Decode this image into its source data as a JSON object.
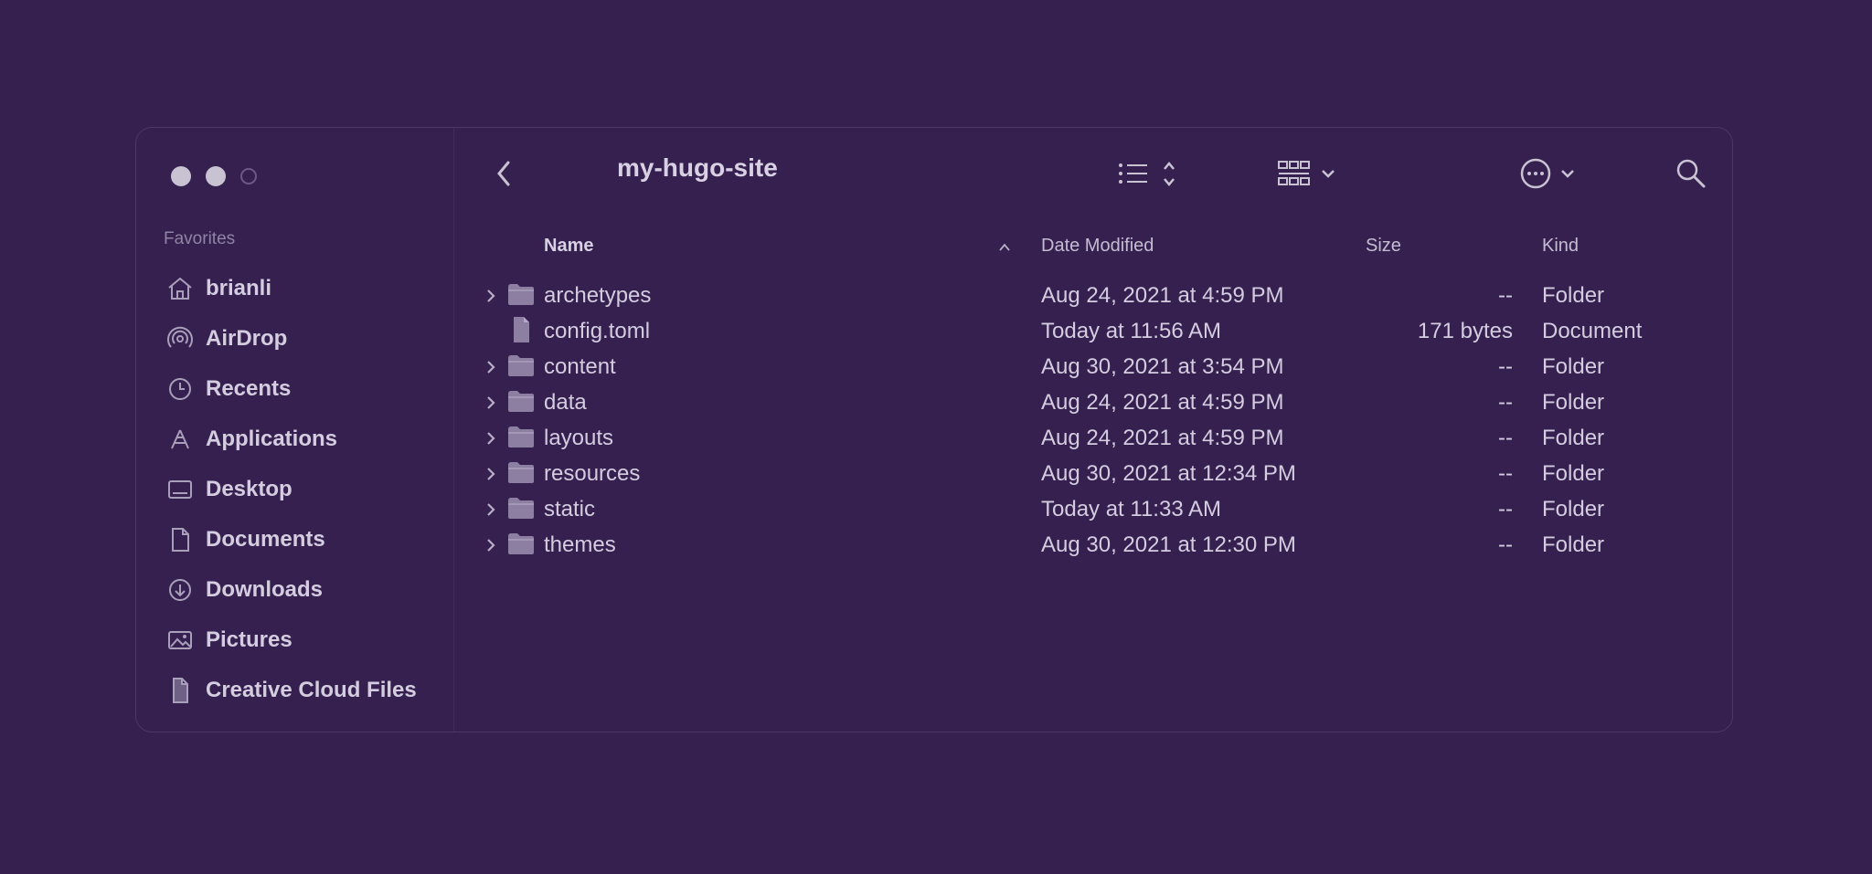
{
  "window": {
    "title": "my-hugo-site"
  },
  "sidebar": {
    "heading": "Favorites",
    "items": [
      {
        "label": "brianli",
        "icon": "home-icon"
      },
      {
        "label": "AirDrop",
        "icon": "airdrop-icon"
      },
      {
        "label": "Recents",
        "icon": "clock-icon"
      },
      {
        "label": "Applications",
        "icon": "applications-icon"
      },
      {
        "label": "Desktop",
        "icon": "desktop-icon"
      },
      {
        "label": "Documents",
        "icon": "document-icon"
      },
      {
        "label": "Downloads",
        "icon": "download-icon"
      },
      {
        "label": "Pictures",
        "icon": "pictures-icon"
      },
      {
        "label": "Creative Cloud Files",
        "icon": "file-icon"
      }
    ]
  },
  "columns": {
    "name": "Name",
    "date": "Date Modified",
    "size": "Size",
    "kind": "Kind"
  },
  "files": [
    {
      "name": "archetypes",
      "date": "Aug 24, 2021 at 4:59 PM",
      "size": "--",
      "kind": "Folder",
      "type": "folder"
    },
    {
      "name": "config.toml",
      "date": "Today at 11:56 AM",
      "size": "171 bytes",
      "kind": "Document",
      "type": "file"
    },
    {
      "name": "content",
      "date": "Aug 30, 2021 at 3:54 PM",
      "size": "--",
      "kind": "Folder",
      "type": "folder"
    },
    {
      "name": "data",
      "date": "Aug 24, 2021 at 4:59 PM",
      "size": "--",
      "kind": "Folder",
      "type": "folder"
    },
    {
      "name": "layouts",
      "date": "Aug 24, 2021 at 4:59 PM",
      "size": "--",
      "kind": "Folder",
      "type": "folder"
    },
    {
      "name": "resources",
      "date": "Aug 30, 2021 at 12:34 PM",
      "size": "--",
      "kind": "Folder",
      "type": "folder"
    },
    {
      "name": "static",
      "date": "Today at 11:33 AM",
      "size": "--",
      "kind": "Folder",
      "type": "folder"
    },
    {
      "name": "themes",
      "date": "Aug 30, 2021 at 12:30 PM",
      "size": "--",
      "kind": "Folder",
      "type": "folder"
    }
  ],
  "colors": {
    "background": "#352050",
    "text": "#d4cde0",
    "muted": "#8f84a3"
  }
}
